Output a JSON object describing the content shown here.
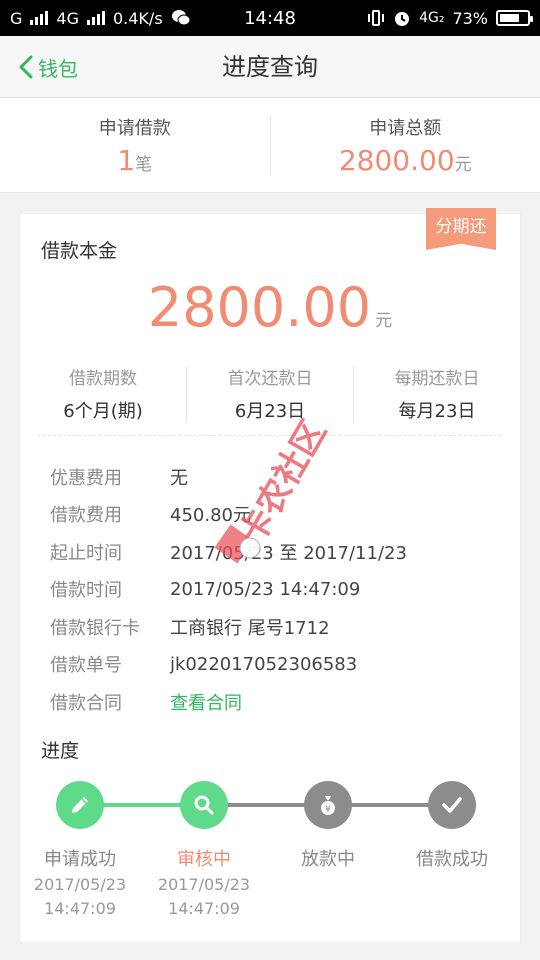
{
  "status_bar": {
    "carrier_left": "G",
    "network": "4G",
    "speed": "0.4K/s",
    "time": "14:48",
    "net_right": "4G₂",
    "battery": "73%",
    "battery_level": 0.73
  },
  "header": {
    "back_label": "钱包",
    "title": "进度查询"
  },
  "summary": {
    "count_label": "申请借款",
    "count_value": "1",
    "count_unit": "笔",
    "total_label": "申请总额",
    "total_value": "2800.00",
    "total_unit": "元"
  },
  "card": {
    "tag": "分期还",
    "principal_label": "借款本金",
    "principal_amount": "2800.00",
    "principal_unit": "元",
    "terms": [
      {
        "label": "借款期数",
        "value": "6个月(期)"
      },
      {
        "label": "首次还款日",
        "value": "6月23日"
      },
      {
        "label": "每期还款日",
        "value": "每月23日"
      }
    ],
    "details": [
      {
        "label": "优惠费用",
        "value": "无"
      },
      {
        "label": "借款费用",
        "value": "450.80元"
      },
      {
        "label": "起止时间",
        "value": "2017/05/23 至 2017/11/23"
      },
      {
        "label": "借款时间",
        "value": "2017/05/23 14:47:09"
      },
      {
        "label": "借款银行卡",
        "value": "工商银行 尾号1712"
      },
      {
        "label": "借款单号",
        "value": "jk022017052306583"
      },
      {
        "label": "借款合同",
        "value": "查看合同"
      }
    ],
    "progress_label": "进度",
    "steps": [
      {
        "name": "申请成功",
        "date": "2017/05/23",
        "time": "14:47:09",
        "state": "done",
        "icon": "pencil-icon"
      },
      {
        "name": "审核中",
        "date": "2017/05/23",
        "time": "14:47:09",
        "state": "active",
        "icon": "search-icon"
      },
      {
        "name": "放款中",
        "date": "",
        "time": "",
        "state": "pending",
        "icon": "money-bag-icon"
      },
      {
        "name": "借款成功",
        "date": "",
        "time": "",
        "state": "pending",
        "icon": "check-icon"
      }
    ]
  },
  "watermark": "卡农社区",
  "colors": {
    "accent_green": "#5fd98a",
    "accent_orange": "#f08c72",
    "pending_gray": "#8c8c8c"
  }
}
